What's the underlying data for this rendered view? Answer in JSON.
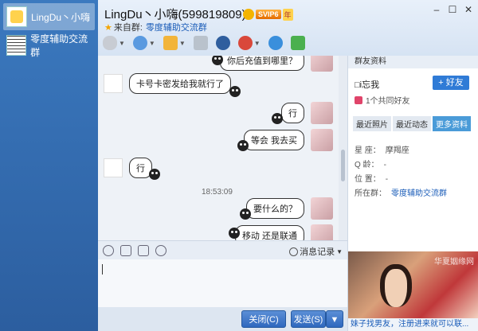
{
  "sessions": [
    {
      "name": "LingDu丶小嗨"
    },
    {
      "name": "零度辅助交流群"
    }
  ],
  "title": {
    "name": "LingDu丶小嗨(599819809)",
    "svip": "SVIP6",
    "year": "年",
    "from_label": "来自群:",
    "from_group": "零度辅助交流群"
  },
  "window_controls": [
    "–",
    "☐",
    "✕"
  ],
  "toolbar_icons": [
    "mic-icon",
    "video-icon",
    "folder-icon",
    "screen-icon",
    "police-icon",
    "remove-user-icon",
    "add-user-icon",
    "chat-bubble-icon"
  ],
  "chat": {
    "messages": [
      {
        "side": "right",
        "text": "你后充值到哪里？"
      },
      {
        "side": "left",
        "text": "卡号卡密发给我就行了"
      },
      {
        "side": "right",
        "text": "行"
      },
      {
        "side": "right",
        "text": "等会  我去买"
      },
      {
        "side": "left",
        "text": "行"
      },
      {
        "side": "right",
        "text": "要什么的？"
      },
      {
        "side": "right",
        "text": "移动 还是联通"
      }
    ],
    "timestamp": "18:53:09"
  },
  "input": {
    "history_label": "消息记录",
    "close_label": "关闭(C)",
    "send_label": "发送(S)"
  },
  "panel": {
    "header": "群友资料",
    "forget": "□i忘我",
    "add_friend": "+ 好友",
    "common_friends": "1个共同好友",
    "tabs": [
      "最近照片",
      "最近动态",
      "更多资料"
    ],
    "info": [
      {
        "label": "星    座：",
        "value": "摩羯座"
      },
      {
        "label": "Q      龄：",
        "value": "-"
      },
      {
        "label": "位    置：",
        "value": "-"
      },
      {
        "label": "所在群：",
        "value": "零度辅助交流群"
      }
    ],
    "ad_watermark": "华夏姻缘网",
    "ad_text": "妹子找男友，注册进来就可以联..."
  }
}
